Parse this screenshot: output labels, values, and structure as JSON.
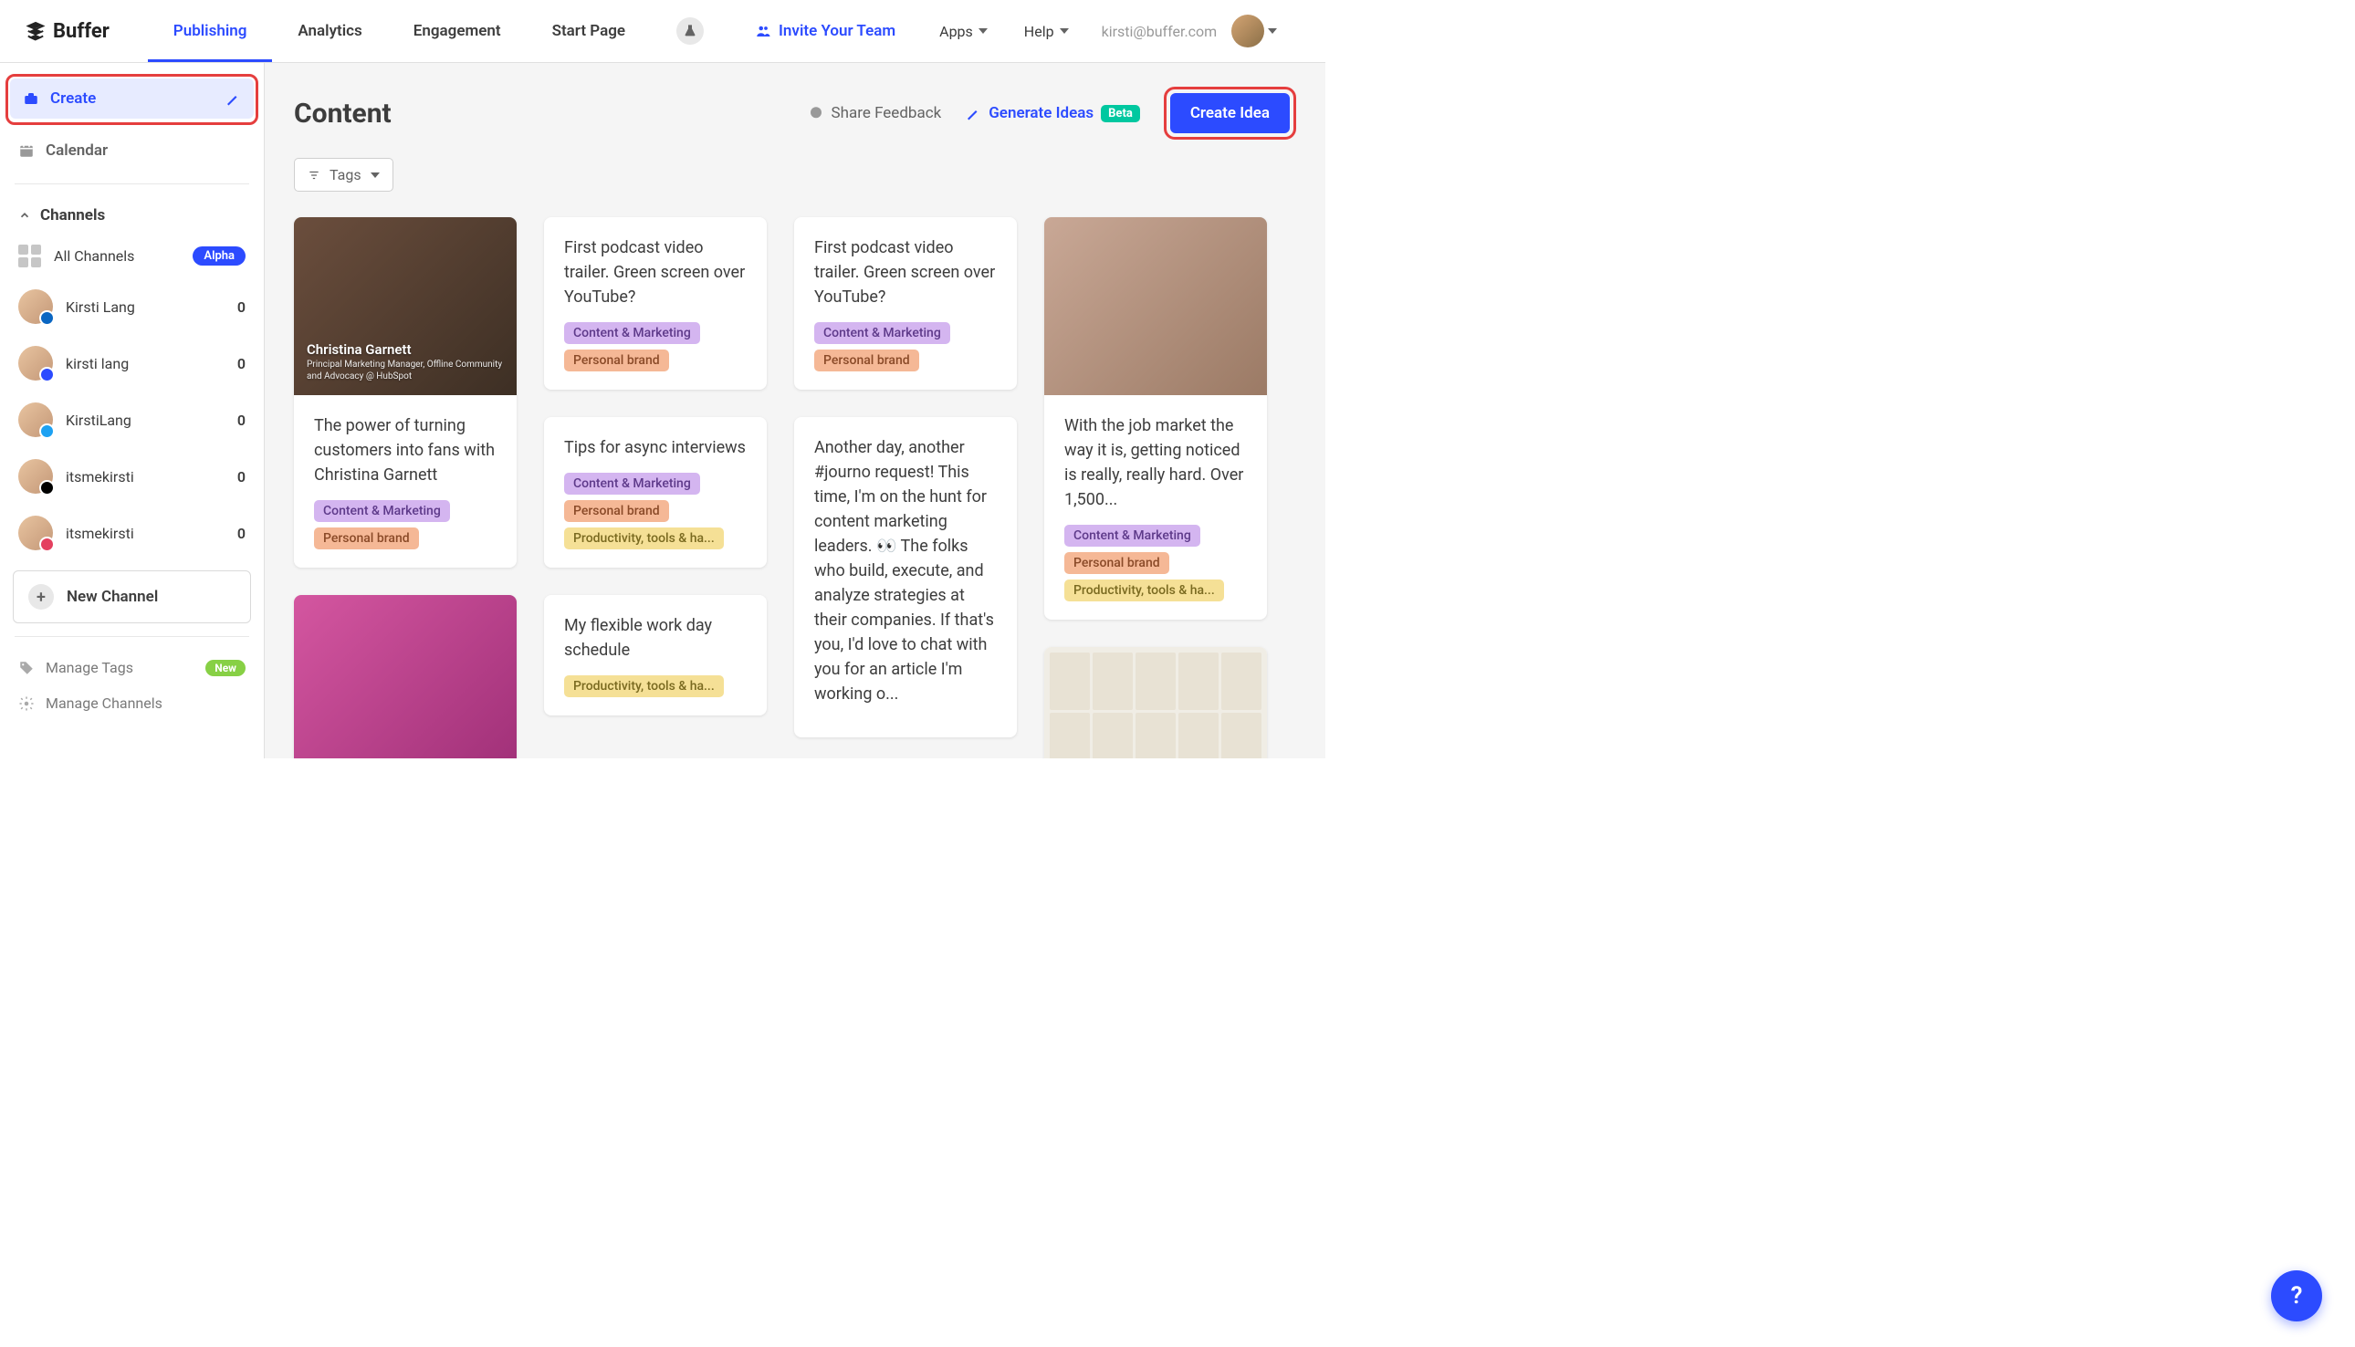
{
  "header": {
    "logo": "Buffer",
    "nav": [
      "Publishing",
      "Analytics",
      "Engagement",
      "Start Page"
    ],
    "invite": "Invite Your Team",
    "apps": "Apps",
    "help": "Help",
    "email": "kirsti@buffer.com"
  },
  "sidebar": {
    "create": "Create",
    "calendar": "Calendar",
    "channels_label": "Channels",
    "all_channels": "All Channels",
    "alpha": "Alpha",
    "channels": [
      {
        "name": "Kirsti Lang",
        "count": "0",
        "net": "li"
      },
      {
        "name": "kirsti lang",
        "count": "0",
        "net": "gb"
      },
      {
        "name": "KirstiLang",
        "count": "0",
        "net": "tw"
      },
      {
        "name": "itsmekirsti",
        "count": "0",
        "net": "tt"
      },
      {
        "name": "itsmekirsti",
        "count": "0",
        "net": "ig"
      }
    ],
    "new_channel": "New Channel",
    "manage_tags": "Manage Tags",
    "new_badge": "New",
    "manage_channels": "Manage Channels"
  },
  "content": {
    "title": "Content",
    "share_feedback": "Share Feedback",
    "generate_ideas": "Generate Ideas",
    "beta": "Beta",
    "create_idea": "Create Idea",
    "tags_filter": "Tags"
  },
  "cards": {
    "c1": {
      "img_label_name": "Christina Garnett",
      "img_label_sub": "Principal Marketing Manager, Offline Community and Advocacy @ HubSpot",
      "text": "The power of turning customers into fans with Christina Garnett",
      "tags": [
        "Content & Marketing",
        "Personal brand"
      ]
    },
    "c2a": {
      "text": "First podcast video trailer. Green screen over YouTube?",
      "tags": [
        "Content & Marketing",
        "Personal brand"
      ]
    },
    "c2b": {
      "text": "Tips for async interviews",
      "tags": [
        "Content & Marketing",
        "Personal brand",
        "Productivity, tools & ha..."
      ]
    },
    "c2c": {
      "text": "My flexible work day schedule",
      "tags": [
        "Productivity, tools & ha..."
      ]
    },
    "c3a": {
      "text": "First podcast video trailer. Green screen over YouTube?",
      "tags": [
        "Content & Marketing",
        "Personal brand"
      ]
    },
    "c3b": {
      "text": "Another day, another #journo request! This time, I'm on the hunt for content marketing leaders. 👀 The folks who build, execute, and analyze strategies at their companies. If that's you, I'd love to chat with you for an article I'm working o...",
      "tags": []
    },
    "c4": {
      "text": "With the job market the way it is, getting noticed is really, really hard. Over 1,500...",
      "tags": [
        "Content & Marketing",
        "Personal brand",
        "Productivity, tools & ha..."
      ]
    }
  },
  "tag_colors": {
    "Content & Marketing": "purple",
    "Personal brand": "orange",
    "Productivity, tools & ha...": "yellow"
  }
}
